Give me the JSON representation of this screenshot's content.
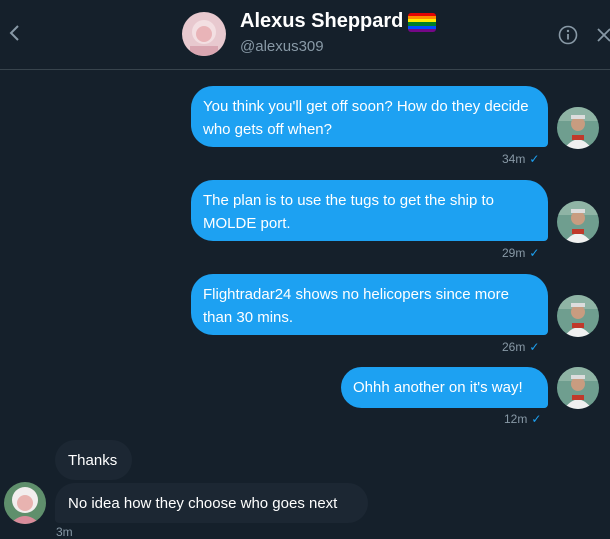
{
  "header": {
    "name": "Alexus Sheppard",
    "handle": "@alexus309",
    "back_icon": "chevron-left-icon",
    "info_icon": "info-icon",
    "close_icon": "close-icon",
    "badge": "rainbow-flag"
  },
  "messages": [
    {
      "text": "You think you'll get off soon?   How do they decide who gets off when?",
      "time": "34m",
      "status": "✓"
    },
    {
      "text": "The plan is to use the tugs to get the ship to MOLDE port.",
      "time": "29m",
      "status": "✓"
    },
    {
      "text": "Flightradar24 shows no helicopers since more than 30 mins.",
      "time": "26m",
      "status": "✓"
    },
    {
      "text": "Ohhh another on it's way!",
      "time": "12m",
      "status": "✓"
    },
    {
      "text": "Thanks"
    },
    {
      "text": "No idea how they choose who goes next",
      "time": "3m"
    }
  ],
  "colors": {
    "background": "#15202b",
    "outgoing_bubble": "#1da1f2",
    "incoming_bubble": "#1c2733",
    "muted_text": "#8899a6"
  }
}
